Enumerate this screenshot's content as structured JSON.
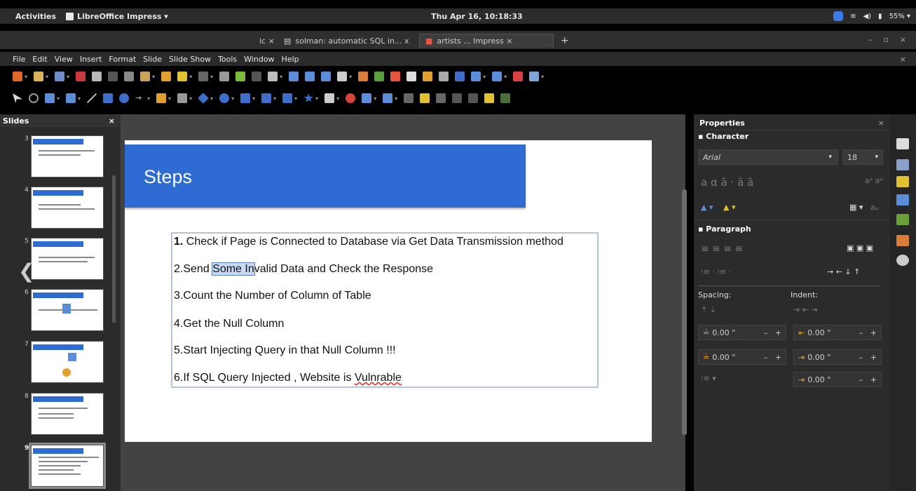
{
  "topbar": {
    "activities": "Activities",
    "app_name": "LibreOffice Impress ▾",
    "clock": "Thu Apr 16, 10:18:33",
    "battery": "55% ▾"
  },
  "browser_tabs": [
    {
      "label": "ic ×"
    },
    {
      "label": "solman: automatic SQL in...  x"
    },
    {
      "label": "artists ... Impress        ×"
    },
    {
      "label": "+"
    }
  ],
  "menu": [
    "File",
    "Edit",
    "View",
    "Insert",
    "Format",
    "Slide",
    "Slide Show",
    "Tools",
    "Window",
    "Help"
  ],
  "slides_pane": {
    "title": "Slides",
    "close": "×",
    "numbers": [
      "3",
      "4",
      "5",
      "6",
      "7",
      "8",
      "9"
    ]
  },
  "slide": {
    "title": "Steps",
    "steps": [
      {
        "num": "1.",
        "text": " Check if Page is Connected to Database via Get Data Transmission method"
      },
      {
        "pre": "2.Send ",
        "selected": "Some In",
        "post": "valid Data and Check the Response"
      },
      {
        "text": "3.Count the Number of Column of Table"
      },
      {
        "text": "4.Get the Null Column"
      },
      {
        "text": "5.Start Injecting Query in that Null Column !!!"
      },
      {
        "pre": "6.If SQL Query Injected , Website is ",
        "misspelled": "Vulnrable"
      }
    ]
  },
  "properties": {
    "title": "Properties",
    "close": "×",
    "character_label": "Character",
    "font_name": "Arial",
    "font_size": "18",
    "paragraph_label": "Paragraph",
    "spacing_label": "Spacing:",
    "indent_label": "Indent:",
    "spacing_above": "0.00 \"",
    "spacing_below": "0.00 \"",
    "indent_before": "0.00 \"",
    "indent_after": "0.00 \"",
    "indent_first": "0.00 \""
  },
  "colors": {
    "accent_blue": "#2e6bd3",
    "ui_dark": "#2b2b2b"
  }
}
